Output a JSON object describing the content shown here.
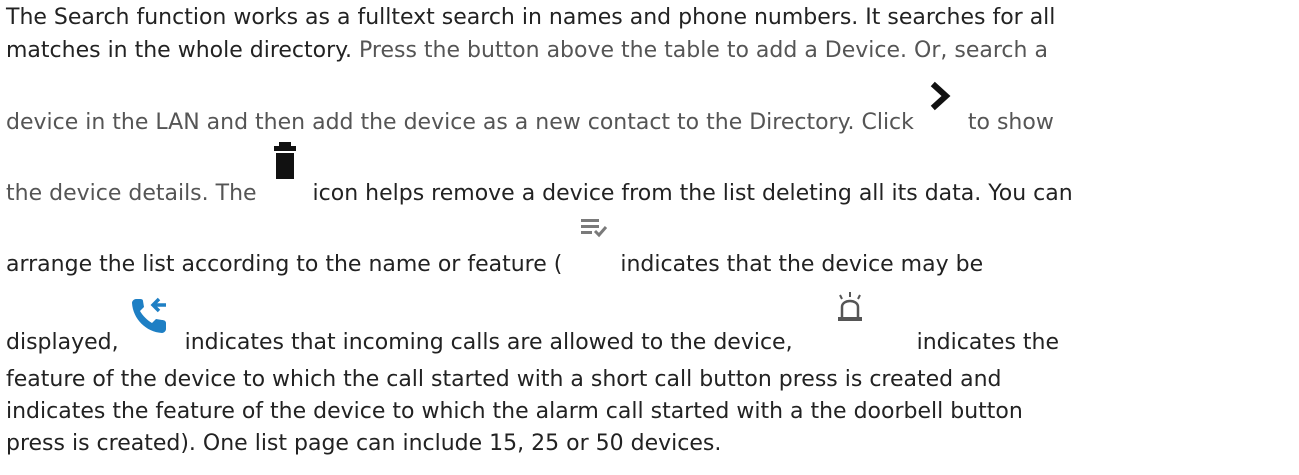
{
  "paragraph": {
    "l1": "The Search function works as a fulltext search in names and phone numbers. It searches for all",
    "l2a": "matches in the whole directory.",
    "l2b": " Press the button above the table to add a Device. Or, search a",
    "l3a": "device in the LAN and then add the device as a new contact to the Directory.  Click",
    "l3b": " to show",
    "l4a": "the device details. The",
    "l4b": " icon helps remove a device from the list deleting all its data. You can",
    "l5a": "arrange the list according to the name or feature (",
    "l5b": " indicates that the device may be",
    "l6a": "displayed,",
    "l6b": " indicates that incoming calls are allowed to the device,",
    "l6c": " indicates the",
    "l7": "feature of the device to which the call started with a short call button press is created and",
    "l8": "indicates the feature of the device to which the alarm call started with a the doorbell button",
    "l9": "press is created). One list page can include 15, 25 or 50 devices."
  },
  "icons": {
    "detail": "chevron-right-icon",
    "delete": "trash-icon",
    "display": "list-check-icon",
    "incoming": "incoming-call-icon",
    "alarm": "alarm-light-icon"
  },
  "colors": {
    "text": "#222222",
    "muted_text": "#555555",
    "icon_dark": "#111111",
    "icon_grey": "#7a7a7a",
    "icon_blue": "#1e7fc4"
  }
}
